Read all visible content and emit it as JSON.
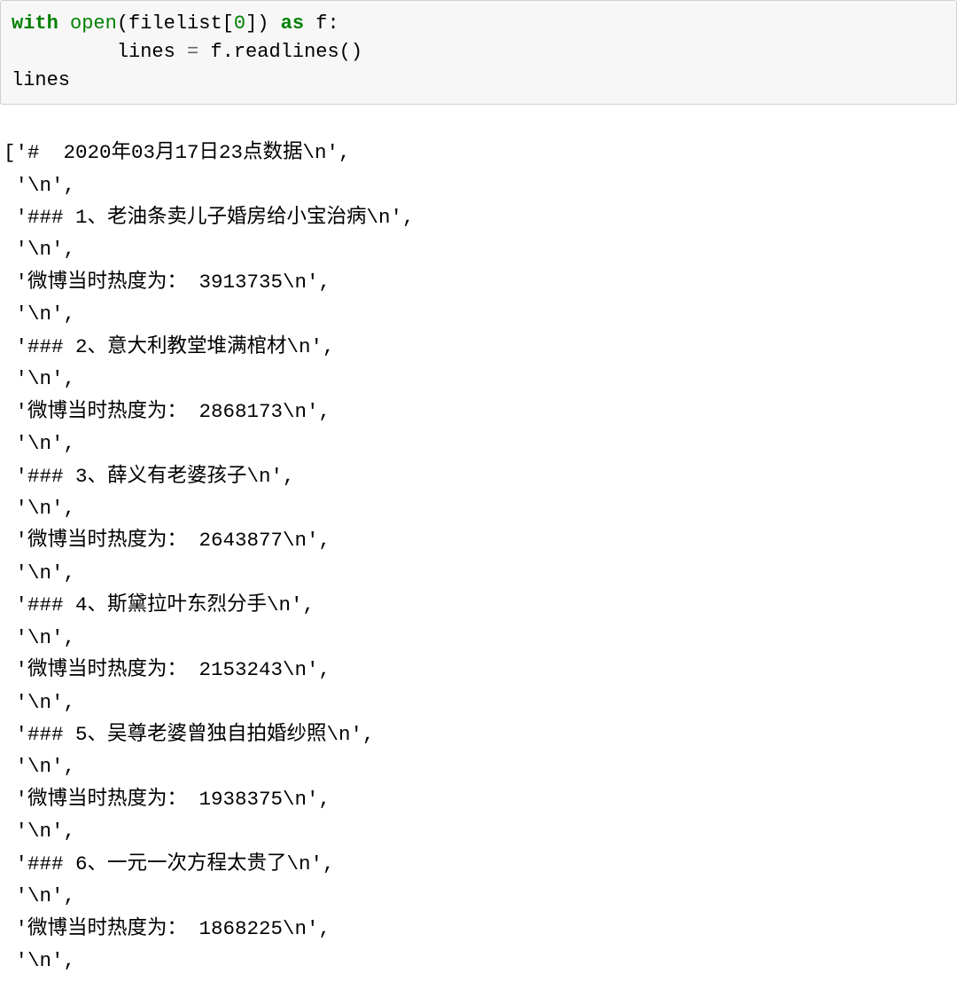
{
  "code": {
    "line1_pre": "with",
    "line1_open": " open",
    "line1_after_open": "(filelist[",
    "line1_zero": "0",
    "line1_after_zero": "]) ",
    "line1_as": "as",
    "line1_f": " f:",
    "line2_indent": "         lines ",
    "line2_eq": "=",
    "line2_rest": " f.readlines()",
    "line3": "lines"
  },
  "output_lines": [
    "['#  2020年03月17日23点数据\\n',",
    " '\\n',",
    " '### 1、老油条卖儿子婚房给小宝治病\\n',",
    " '\\n',",
    " '微博当时热度为： 3913735\\n',",
    " '\\n',",
    " '### 2、意大利教堂堆满棺材\\n',",
    " '\\n',",
    " '微博当时热度为： 2868173\\n',",
    " '\\n',",
    " '### 3、薛义有老婆孩子\\n',",
    " '\\n',",
    " '微博当时热度为： 2643877\\n',",
    " '\\n',",
    " '### 4、斯黛拉叶东烈分手\\n',",
    " '\\n',",
    " '微博当时热度为： 2153243\\n',",
    " '\\n',",
    " '### 5、吴尊老婆曾独自拍婚纱照\\n',",
    " '\\n',",
    " '微博当时热度为： 1938375\\n',",
    " '\\n',",
    " '### 6、一元一次方程太贵了\\n',",
    " '\\n',",
    " '微博当时热度为： 1868225\\n',",
    " '\\n',"
  ]
}
